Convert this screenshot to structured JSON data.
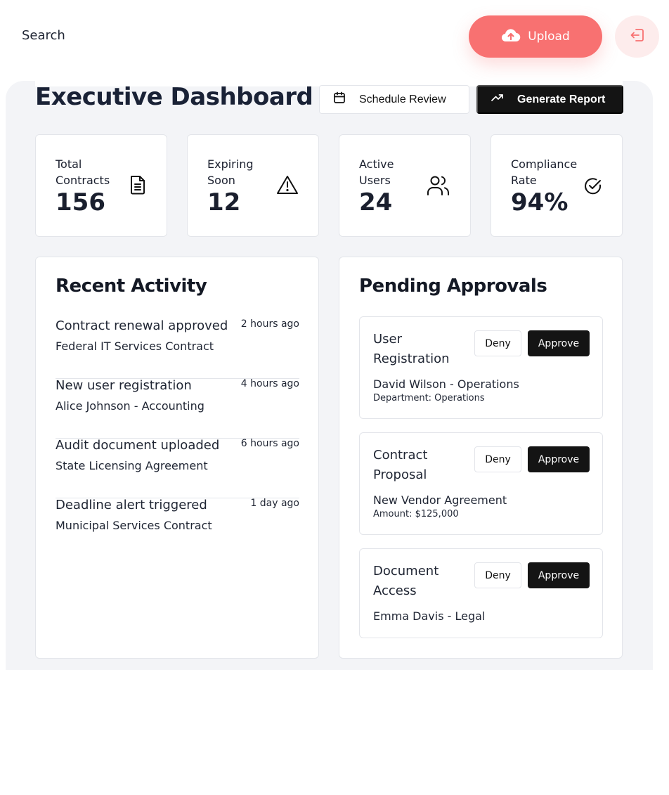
{
  "topbar": {
    "search_label": "Search",
    "upload_label": "Upload",
    "upload_icon": "cloud-upload-icon",
    "logout_icon": "logout-icon",
    "accent_color": "#f87171"
  },
  "header": {
    "title": "Executive Dashboard",
    "schedule_label": "Schedule Review",
    "schedule_icon": "calendar-icon",
    "report_label": "Generate Report",
    "report_icon": "trending-up-icon"
  },
  "stats": [
    {
      "label_line1": "Total",
      "label_line2": "Contracts",
      "value": "156",
      "icon": "document-icon"
    },
    {
      "label_line1": "Expiring",
      "label_line2": "Soon",
      "value": "12",
      "icon": "warning-icon"
    },
    {
      "label_line1": "Active",
      "label_line2": "Users",
      "value": "24",
      "icon": "users-icon"
    },
    {
      "label_line1": "Compliance",
      "label_line2": "Rate",
      "value": "94%",
      "icon": "check-circle-icon"
    }
  ],
  "recent_activity": {
    "title": "Recent Activity",
    "items": [
      {
        "title": "Contract renewal approved",
        "time": "2 hours ago",
        "subtitle": "Federal IT Services Contract"
      },
      {
        "title": "New user registration",
        "time": "4 hours ago",
        "subtitle": "Alice Johnson - Accounting"
      },
      {
        "title": "Audit document uploaded",
        "time": "6 hours ago",
        "subtitle": "State Licensing Agreement"
      },
      {
        "title": "Deadline alert triggered",
        "time": "1 day ago",
        "subtitle": "Municipal Services Contract"
      }
    ]
  },
  "pending_approvals": {
    "title": "Pending Approvals",
    "deny_label": "Deny",
    "approve_label": "Approve",
    "items": [
      {
        "title": "User Registration",
        "subtitle": "David Wilson - Operations",
        "detail": "Department: Operations"
      },
      {
        "title": "Contract Proposal",
        "subtitle": "New Vendor Agreement",
        "detail": "Amount: $125,000"
      },
      {
        "title": "Document Access",
        "subtitle": "Emma Davis - Legal",
        "detail": ""
      }
    ]
  }
}
